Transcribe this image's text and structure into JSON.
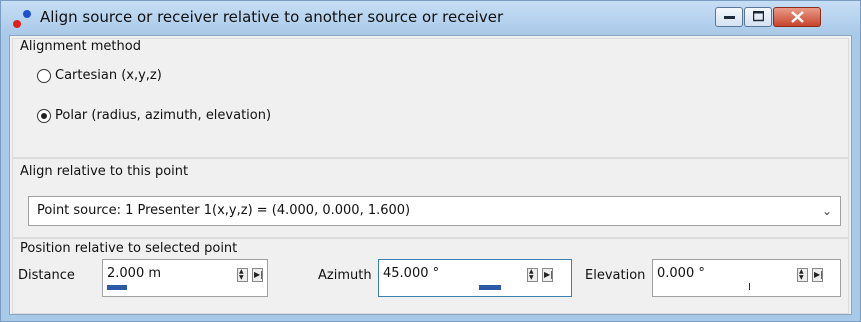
{
  "window": {
    "title": "Align source or receiver relative to another source or receiver",
    "icon": "app-icon-red-blue-dots",
    "buttons": [
      "minimize-icon",
      "maximize-icon",
      "close-icon"
    ]
  },
  "alignment_method": {
    "label": "Alignment method",
    "options": [
      {
        "label": "Cartesian (x,y,z)",
        "selected": false
      },
      {
        "label": "Polar (radius, azimuth, elevation)",
        "selected": true
      }
    ]
  },
  "align_relative": {
    "label": "Align relative to this point",
    "selected": "Point source: 1 Presenter 1(x,y,z) = (4.000, 0.000, 1.600)"
  },
  "position": {
    "label": "Position relative to selected point",
    "distance": {
      "label": "Distance",
      "value": "2.000 m",
      "level": 0.05
    },
    "azimuth": {
      "label": "Azimuth",
      "value": "45.000 °",
      "level": 0.625
    },
    "elevation": {
      "label": "Elevation",
      "value": "0.000 °",
      "level": 0.5
    }
  },
  "colors": {
    "accent": "#2c5aa8",
    "titlebar": "#a9c9e8",
    "close": "#c8442c"
  }
}
